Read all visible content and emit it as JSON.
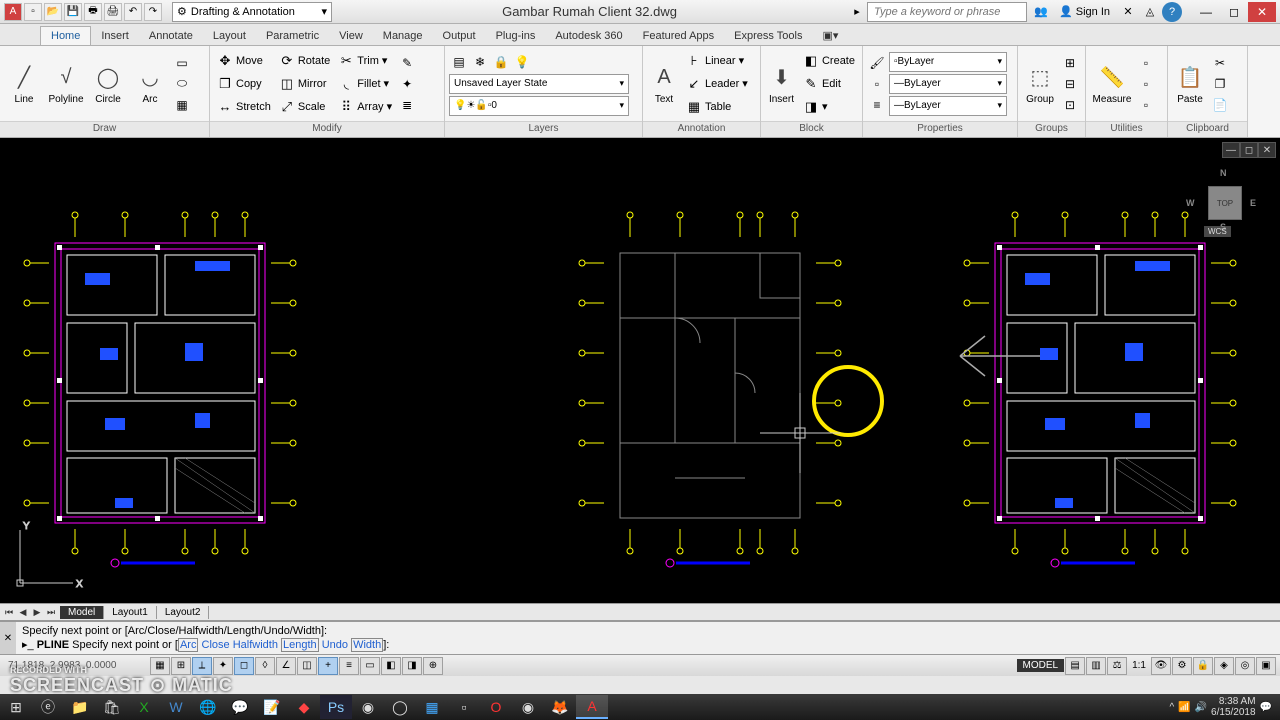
{
  "title": "Gambar Rumah Client 32.dwg",
  "workspace": "Drafting & Annotation",
  "search_placeholder": "Type a keyword or phrase",
  "signin": "Sign In",
  "tabs": [
    "Home",
    "Insert",
    "Annotate",
    "Layout",
    "Parametric",
    "View",
    "Manage",
    "Output",
    "Plug-ins",
    "Autodesk 360",
    "Featured Apps",
    "Express Tools"
  ],
  "draw": {
    "line": "Line",
    "polyline": "Polyline",
    "circle": "Circle",
    "arc": "Arc",
    "panel": "Draw"
  },
  "modify": {
    "move": "Move",
    "copy": "Copy",
    "stretch": "Stretch",
    "rotate": "Rotate",
    "mirror": "Mirror",
    "scale": "Scale",
    "trim": "Trim",
    "fillet": "Fillet",
    "array": "Array",
    "panel": "Modify"
  },
  "layers": {
    "state": "Unsaved Layer State",
    "current": "0",
    "panel": "Layers"
  },
  "annotation": {
    "text": "Text",
    "linear": "Linear",
    "leader": "Leader",
    "table": "Table",
    "panel": "Annotation"
  },
  "block": {
    "insert": "Insert",
    "create": "Create",
    "edit": "Edit",
    "panel": "Block"
  },
  "props": {
    "bylayer1": "ByLayer",
    "bylayer2": "ByLayer",
    "bylayer3": "ByLayer",
    "panel": "Properties"
  },
  "groups": {
    "label": "Group",
    "panel": "Groups"
  },
  "utilities": {
    "label": "Measure",
    "panel": "Utilities"
  },
  "clipboard": {
    "label": "Paste",
    "panel": "Clipboard"
  },
  "viewcube": {
    "top": "TOP",
    "n": "N",
    "s": "S",
    "e": "E",
    "w": "W",
    "wcs": "WCS"
  },
  "model_tabs": {
    "model": "Model",
    "l1": "Layout1",
    "l2": "Layout2"
  },
  "cmd": {
    "line1": "Specify next point or [Arc/Close/Halfwidth/Length/Undo/Width]:",
    "prefix": "PLINE",
    "prompt": "Specify next point or [",
    "arc": "Arc",
    "close": "Close",
    "half": "Halfwidth",
    "length": "Length",
    "undo": "Undo",
    "width": "Width",
    "end": "]:"
  },
  "status": {
    "coords": "71.1818, 2.9983, 0.0000",
    "model": "MODEL",
    "scale": "1:1"
  },
  "watermark": {
    "big": "SCREENCAST",
    "omatic": "MATIC",
    "small": "RECORDED WITH"
  },
  "taskbar": {
    "time": "8:38 AM",
    "date": "6/15/2018"
  }
}
